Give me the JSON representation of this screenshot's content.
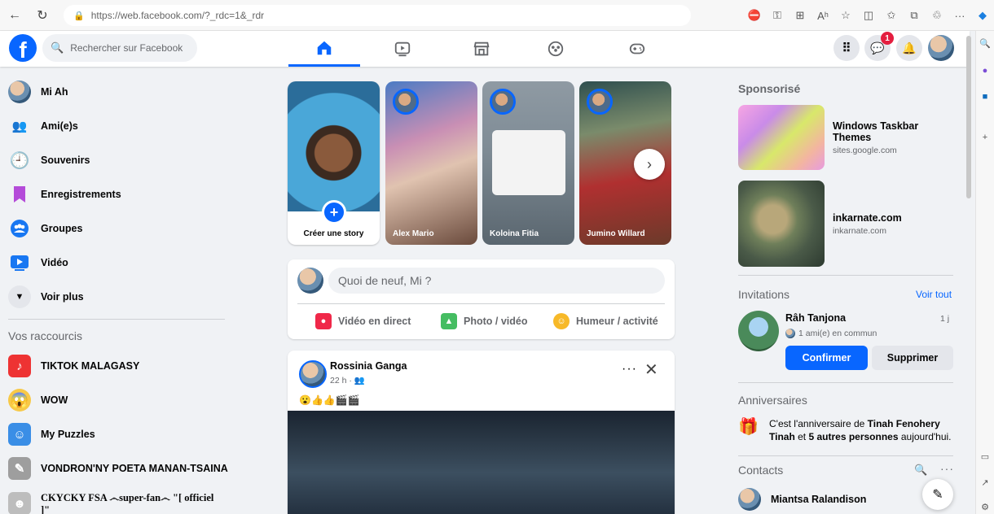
{
  "browser": {
    "url": "https://web.facebook.com/?_rdc=1&_rdr"
  },
  "header": {
    "search_placeholder": "Rechercher sur Facebook",
    "messenger_badge": "1"
  },
  "sidebar": {
    "items": [
      {
        "label": "Mi Ah",
        "icon": "profile-avatar"
      },
      {
        "label": "Ami(e)s",
        "icon": "friends-icon",
        "color": "#1877f2"
      },
      {
        "label": "Souvenirs",
        "icon": "clock-icon",
        "color": "#1877f2"
      },
      {
        "label": "Enregistrements",
        "icon": "bookmark-icon",
        "color": "#a33fd1"
      },
      {
        "label": "Groupes",
        "icon": "groups-icon",
        "color": "#1877f2"
      },
      {
        "label": "Vidéo",
        "icon": "video-icon",
        "color": "#1877f2"
      },
      {
        "label": "Voir plus",
        "icon": "chevron-down-icon"
      }
    ],
    "shortcuts_title": "Vos raccourcis",
    "shortcuts": [
      {
        "label": "TIKTOK MALAGASY"
      },
      {
        "label": "WOW"
      },
      {
        "label": "My Puzzles"
      },
      {
        "label": "VONDRON'NY POETA MANAN-TSAINA"
      },
      {
        "label": "CKYCKY FSA ෴super-fan෴ \"[ officiel ]\""
      }
    ]
  },
  "stories": {
    "create_label": "Créer une story",
    "items": [
      {
        "name": "Alex Mario"
      },
      {
        "name": "Koloina Fitia"
      },
      {
        "name": "Jumino Willard"
      }
    ]
  },
  "composer": {
    "placeholder": "Quoi de neuf, Mi ?",
    "live_label": "Vidéo en direct",
    "photo_label": "Photo / vidéo",
    "feeling_label": "Humeur / activité"
  },
  "post": {
    "author": "Rossinia Ganga",
    "time": "22 h · 👥",
    "text": "😮👍👍🎬🎬"
  },
  "right": {
    "sponsored_title": "Sponsorisé",
    "ads": [
      {
        "title": "Windows Taskbar Themes",
        "domain": "sites.google.com"
      },
      {
        "title": "inkarnate.com",
        "domain": "inkarnate.com"
      }
    ],
    "invitations_title": "Invitations",
    "see_all": "Voir tout",
    "invite": {
      "name": "Râh Tanjona",
      "time": "1 j",
      "mutual": "1 ami(e) en commun",
      "confirm": "Confirmer",
      "delete": "Supprimer"
    },
    "birthdays_title": "Anniversaires",
    "birthday_pre": "C'est l'anniversaire de ",
    "birthday_name": "Tinah Fenohery Tinah",
    "birthday_mid": " et ",
    "birthday_others": "5 autres personnes",
    "birthday_post": " aujourd'hui.",
    "contacts_title": "Contacts",
    "contacts": [
      {
        "name": "Miantsa Ralandison"
      }
    ]
  }
}
